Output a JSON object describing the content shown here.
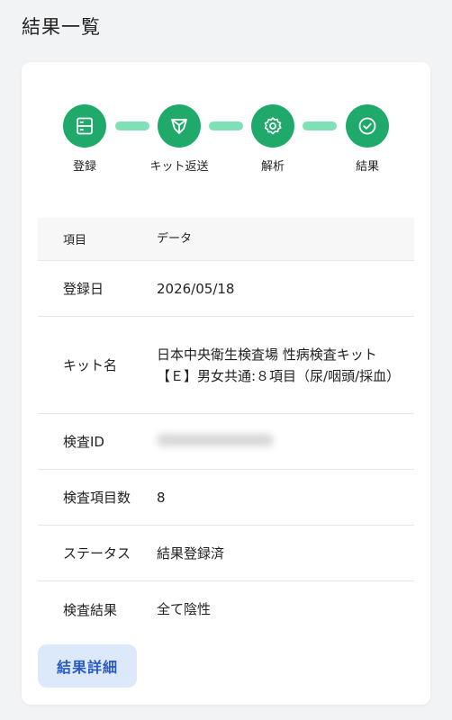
{
  "page": {
    "title": "結果一覧"
  },
  "stepper": {
    "steps": [
      {
        "label": "登録",
        "icon": "server-icon"
      },
      {
        "label": "キット返送",
        "icon": "shield-icon"
      },
      {
        "label": "解析",
        "icon": "gear-icon"
      },
      {
        "label": "結果",
        "icon": "check-circle-icon"
      }
    ],
    "colors": {
      "active": "#1faa6b",
      "connector": "#7fe0b8"
    }
  },
  "table": {
    "headers": {
      "item": "項目",
      "data": "データ"
    },
    "rows": [
      {
        "label": "登録日",
        "value": "2026/05/18"
      },
      {
        "label": "キット名",
        "value": "日本中央衛生検査場 性病検査キット【Ｅ】男女共通:８項目（尿/咽頭/採血）"
      },
      {
        "label": "検査ID",
        "value": ""
      },
      {
        "label": "検査項目数",
        "value": "8"
      },
      {
        "label": "ステータス",
        "value": "結果登録済"
      },
      {
        "label": "検査結果",
        "value": "全て陰性"
      }
    ]
  },
  "actions": {
    "detail_label": "結果詳細"
  }
}
